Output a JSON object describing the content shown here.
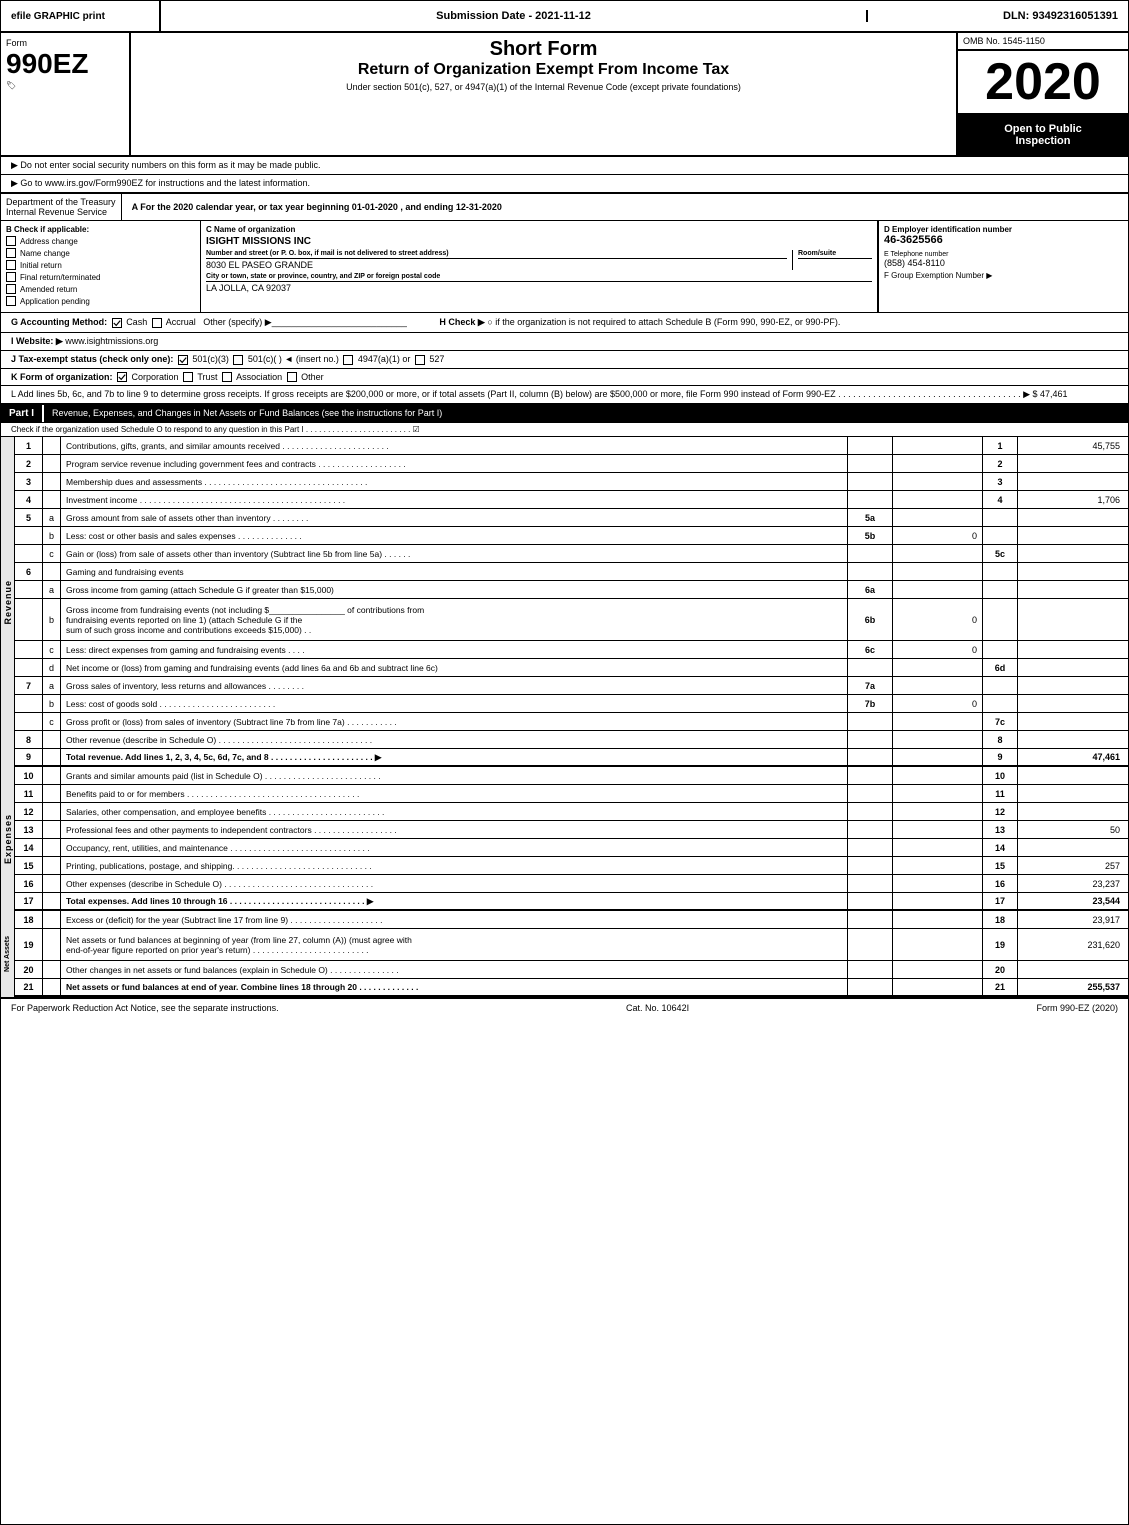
{
  "topbar": {
    "left": "efile GRAPHIC print",
    "mid": "Submission Date - 2021-11-12",
    "right": "DLN: 93492316051391"
  },
  "header": {
    "omb": "OMB No. 1545-1150",
    "form_label": "Form",
    "form_number": "990EZ",
    "form_sub": "🏷",
    "title1": "Short Form",
    "title2": "Return of Organization Exempt From Income Tax",
    "subtitle": "Under section 501(c), 527, or 4947(a)(1) of the Internal Revenue Code (except private foundations)",
    "year": "2020",
    "open_inspection": "Open to Public Inspection"
  },
  "warnings": {
    "ssn": "▶ Do not enter social security numbers on this form as it may be made public.",
    "instructions": "▶ Go to www.irs.gov/Form990EZ for instructions and the latest information."
  },
  "dept": {
    "name": "Department of the Treasury",
    "sub": "Internal Revenue Service"
  },
  "taxyear": {
    "text": "A For the 2020 calendar year, or tax year beginning 01-01-2020 , and ending 12-31-2020"
  },
  "checkboxes": {
    "b_label": "B Check if applicable:",
    "items": [
      {
        "label": "Address change",
        "checked": false
      },
      {
        "label": "Name change",
        "checked": false
      },
      {
        "label": "Initial return",
        "checked": false
      },
      {
        "label": "Final return/terminated",
        "checked": false
      },
      {
        "label": "Amended return",
        "checked": false
      },
      {
        "label": "Application pending",
        "checked": false
      }
    ]
  },
  "org": {
    "c_label": "C Name of organization",
    "name": "ISIGHT MISSIONS INC",
    "address_label": "Number and street (or P. O. box, if mail is not delivered to street address)",
    "address": "8030 EL PASEO GRANDE",
    "room_label": "Room/suite",
    "room": "",
    "city_label": "City or town, state or province, country, and ZIP or foreign postal code",
    "city": "LA JOLLA, CA  92037"
  },
  "ein": {
    "d_label": "D Employer identification number",
    "value": "46-3625566",
    "e_label": "E Telephone number",
    "phone": "(858) 454-8110",
    "f_label": "F Group Exemption Number",
    "f_arrow": "▶"
  },
  "accounting": {
    "g_label": "G Accounting Method:",
    "cash": "Cash",
    "accrual": "Accrual",
    "other": "Other (specify) ▶",
    "cash_checked": true
  },
  "h_check": {
    "label": "H Check ▶",
    "text": "○ if the organization is not required to attach Schedule B (Form 990, 990-EZ, or 990-PF)."
  },
  "website": {
    "label": "I Website: ▶",
    "url": "www.isightmissions.org"
  },
  "tax_exempt": {
    "label": "J Tax-exempt status (check only one):",
    "options": [
      "501(c)(3)",
      "501(c)(  ) ◄ (insert no.)",
      "4947(a)(1) or",
      "527"
    ],
    "checked_index": 0
  },
  "k_row": {
    "label": "K Form of organization:",
    "options": [
      "Corporation",
      "Trust",
      "Association",
      "Other"
    ],
    "checked_index": 0
  },
  "l_row": {
    "text": "L Add lines 5b, 6c, and 7b to line 9 to determine gross receipts. If gross receipts are $200,000 or more, or if total assets (Part II, column (B) below) are $500,000 or more, file Form 990 instead of Form 990-EZ . . . . . . . . . . . . . . . . . . . . . . . . . . . . . . . . . . . . . ▶ $ 47,461"
  },
  "part1": {
    "header": "Part I",
    "header_desc": "Revenue, Expenses, and Changes in Net Assets or Fund Balances (see the instructions for Part I)",
    "check_row": "Check if the organization used Schedule O to respond to any question in this Part I . . . . . . . . . . . . . . . . . . . . . . . . ☑"
  },
  "revenue_rows": [
    {
      "num": "1",
      "sub": "",
      "desc": "Contributions, gifts, grants, and similar amounts received . . . . . . . . . . . . . . . . . . . . . . .",
      "mid_num": "",
      "mid_val": "",
      "line_num": "1",
      "value": "45,755"
    },
    {
      "num": "2",
      "sub": "",
      "desc": "Program service revenue including government fees and contracts . . . . . . . . . . . . . . . . . . .",
      "mid_num": "",
      "mid_val": "",
      "line_num": "2",
      "value": ""
    },
    {
      "num": "3",
      "sub": "",
      "desc": "Membership dues and assessments . . . . . . . . . . . . . . . . . . . . . . . . . . . . . . . . . . .",
      "mid_num": "",
      "mid_val": "",
      "line_num": "3",
      "value": ""
    },
    {
      "num": "4",
      "sub": "",
      "desc": "Investment income . . . . . . . . . . . . . . . . . . . . . . . . . . . . . . . . . . . . . . . . . . . .",
      "mid_num": "",
      "mid_val": "",
      "line_num": "4",
      "value": "1,706"
    },
    {
      "num": "5",
      "sub": "a",
      "desc": "Gross amount from sale of assets other than inventory . . . . . . . .",
      "mid_num": "5a",
      "mid_val": "",
      "line_num": "",
      "value": ""
    },
    {
      "num": "",
      "sub": "b",
      "desc": "Less: cost or other basis and sales expenses . . . . . . . . . . . . . .",
      "mid_num": "5b",
      "mid_val": "0",
      "line_num": "",
      "value": ""
    },
    {
      "num": "",
      "sub": "c",
      "desc": "Gain or (loss) from sale of assets other than inventory (Subtract line 5b from line 5a) . . . . . .",
      "mid_num": "",
      "mid_val": "",
      "line_num": "5c",
      "value": ""
    },
    {
      "num": "6",
      "sub": "",
      "desc": "Gaming and fundraising events",
      "mid_num": "",
      "mid_val": "",
      "line_num": "",
      "value": ""
    },
    {
      "num": "",
      "sub": "a",
      "desc": "Gross income from gaming (attach Schedule G if greater than $15,000)",
      "mid_num": "6a",
      "mid_val": "",
      "line_num": "",
      "value": ""
    },
    {
      "num": "",
      "sub": "b",
      "desc": "Gross income from fundraising events (not including $________________ of contributions from fundraising events reported on line 1) (attach Schedule G if the sum of such gross income and contributions exceeds $15,000) . .",
      "mid_num": "6b",
      "mid_val": "0",
      "line_num": "",
      "value": ""
    },
    {
      "num": "",
      "sub": "c",
      "desc": "Less: direct expenses from gaming and fundraising events . . . . .",
      "mid_num": "6c",
      "mid_val": "0",
      "line_num": "",
      "value": ""
    },
    {
      "num": "",
      "sub": "d",
      "desc": "Net income or (loss) from gaming and fundraising events (add lines 6a and 6b and subtract line 6c)",
      "mid_num": "",
      "mid_val": "",
      "line_num": "6d",
      "value": ""
    },
    {
      "num": "7",
      "sub": "a",
      "desc": "Gross sales of inventory, less returns and allowances . . . . . . . .",
      "mid_num": "7a",
      "mid_val": "",
      "line_num": "",
      "value": ""
    },
    {
      "num": "",
      "sub": "b",
      "desc": "Less: cost of goods sold . . . . . . . . . . . . . . . . . . . . . . . . .",
      "mid_num": "7b",
      "mid_val": "0",
      "line_num": "",
      "value": ""
    },
    {
      "num": "",
      "sub": "c",
      "desc": "Gross profit or (loss) from sales of inventory (Subtract line 7b from line 7a) . . . . . . . . . . .",
      "mid_num": "",
      "mid_val": "",
      "line_num": "7c",
      "value": ""
    },
    {
      "num": "8",
      "sub": "",
      "desc": "Other revenue (describe in Schedule O) . . . . . . . . . . . . . . . . . . . . . . . . . . . . . . . . .",
      "mid_num": "",
      "mid_val": "",
      "line_num": "8",
      "value": ""
    },
    {
      "num": "9",
      "sub": "",
      "desc": "Total revenue. Add lines 1, 2, 3, 4, 5c, 6d, 7c, and 8 . . . . . . . . . . . . . . . . . . . . . . ▶",
      "mid_num": "",
      "mid_val": "",
      "line_num": "9",
      "value": "47,461",
      "bold": true
    }
  ],
  "expense_rows": [
    {
      "num": "10",
      "sub": "",
      "desc": "Grants and similar amounts paid (list in Schedule O) . . . . . . . . . . . . . . . . . . . . . . . . .",
      "mid_num": "",
      "mid_val": "",
      "line_num": "10",
      "value": ""
    },
    {
      "num": "11",
      "sub": "",
      "desc": "Benefits paid to or for members . . . . . . . . . . . . . . . . . . . . . . . . . . . . . . . . . . . . .",
      "mid_num": "",
      "mid_val": "",
      "line_num": "11",
      "value": ""
    },
    {
      "num": "12",
      "sub": "",
      "desc": "Salaries, other compensation, and employee benefits . . . . . . . . . . . . . . . . . . . . . . . . .",
      "mid_num": "",
      "mid_val": "",
      "line_num": "12",
      "value": ""
    },
    {
      "num": "13",
      "sub": "",
      "desc": "Professional fees and other payments to independent contractors . . . . . . . . . . . . . . . . . .",
      "mid_num": "",
      "mid_val": "",
      "line_num": "13",
      "value": "50"
    },
    {
      "num": "14",
      "sub": "",
      "desc": "Occupancy, rent, utilities, and maintenance . . . . . . . . . . . . . . . . . . . . . . . . . . . . . .",
      "mid_num": "",
      "mid_val": "",
      "line_num": "14",
      "value": ""
    },
    {
      "num": "15",
      "sub": "",
      "desc": "Printing, publications, postage, and shipping. . . . . . . . . . . . . . . . . . . . . . . . . . . . . .",
      "mid_num": "",
      "mid_val": "",
      "line_num": "15",
      "value": "257"
    },
    {
      "num": "16",
      "sub": "",
      "desc": "Other expenses (describe in Schedule O) . . . . . . . . . . . . . . . . . . . . . . . . . . . . . . . .",
      "mid_num": "",
      "mid_val": "",
      "line_num": "16",
      "value": "23,237"
    },
    {
      "num": "17",
      "sub": "",
      "desc": "Total expenses. Add lines 10 through 16 . . . . . . . . . . . . . . . . . . . . . . . . . . . . . ▶",
      "mid_num": "",
      "mid_val": "",
      "line_num": "17",
      "value": "23,544",
      "bold": true
    }
  ],
  "netasset_rows": [
    {
      "num": "18",
      "sub": "",
      "desc": "Excess or (deficit) for the year (Subtract line 17 from line 9) . . . . . . . . . . . . . . . . . . . .",
      "mid_num": "",
      "mid_val": "",
      "line_num": "18",
      "value": "23,917"
    },
    {
      "num": "19",
      "sub": "",
      "desc": "Net assets or fund balances at beginning of year (from line 27, column (A)) (must agree with end-of-year figure reported on prior year's return) . . . . . . . . . . . . . . . . . . . . . . . . .",
      "mid_num": "",
      "mid_val": "",
      "line_num": "19",
      "value": "231,620"
    },
    {
      "num": "20",
      "sub": "",
      "desc": "Other changes in net assets or fund balances (explain in Schedule O) . . . . . . . . . . . . . . .",
      "mid_num": "",
      "mid_val": "",
      "line_num": "20",
      "value": ""
    },
    {
      "num": "21",
      "sub": "",
      "desc": "Net assets or fund balances at end of year. Combine lines 18 through 20 . . . . . . . . . . . . .",
      "mid_num": "",
      "mid_val": "",
      "line_num": "21",
      "value": "255,537",
      "bold": true
    }
  ],
  "footer": {
    "left": "For Paperwork Reduction Act Notice, see the separate instructions.",
    "mid": "Cat. No. 10642I",
    "right": "Form 990-EZ (2020)"
  }
}
